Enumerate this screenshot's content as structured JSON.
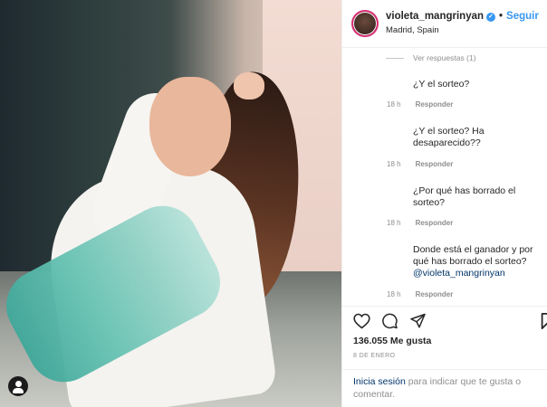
{
  "post": {
    "username": "violeta_mangrinyan",
    "separator": "•",
    "follow_label": "Seguir",
    "location": "Madrid, Spain"
  },
  "comments": {
    "view_replies": "Ver respuestas (1)",
    "items": [
      {
        "text": "¿Y el sorteo?",
        "time": "18 h",
        "reply": "Responder"
      },
      {
        "text": "¿Y el sorteo? Ha desaparecido??",
        "time": "18 h",
        "reply": "Responder"
      },
      {
        "text": "¿Por qué has borrado el sorteo?",
        "time": "18 h",
        "reply": "Responder"
      },
      {
        "text": "Donde está el ganador y por qué has borrado el sorteo?",
        "mention": "@violeta_mangrinyan",
        "time": "18 h",
        "reply": "Responder"
      }
    ]
  },
  "actions": {
    "likes": "136.055 Me gusta",
    "date": "8 DE ENERO",
    "login_link": "Inicia sesión",
    "login_text": " para indicar que te gusta o comentar."
  },
  "icons": {
    "heart": "heart-icon",
    "comment": "comment-icon",
    "share": "share-icon",
    "bookmark": "bookmark-icon",
    "verified": "verified-badge-icon",
    "tagged_user": "user-tag-icon"
  },
  "colors": {
    "accent": "#3897f0",
    "link": "#003569",
    "muted": "#8e8e8e"
  }
}
